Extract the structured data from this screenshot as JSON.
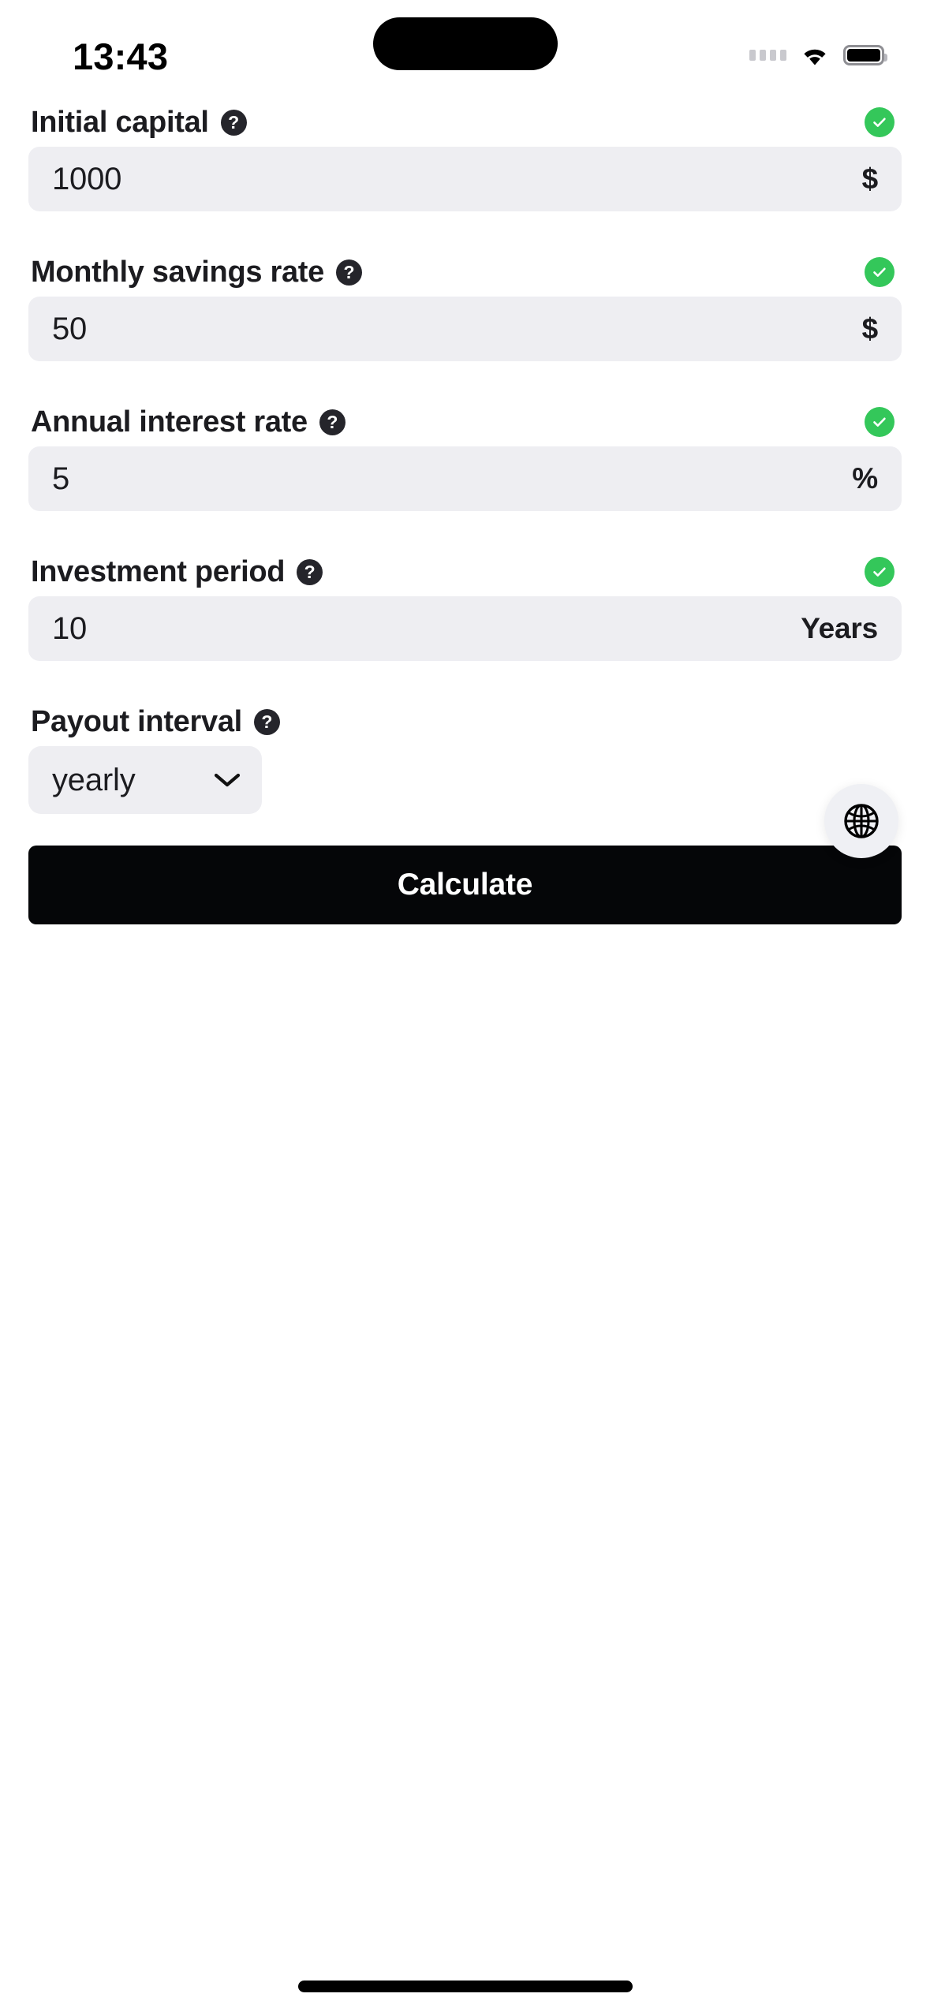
{
  "status_bar": {
    "time": "13:43",
    "signal_icon": "signal-dots-icon",
    "wifi_icon": "wifi-icon",
    "battery_icon": "battery-full-icon"
  },
  "form": {
    "help_glyph": "?",
    "fields": [
      {
        "label": "Initial capital",
        "value": "1000",
        "suffix": "$",
        "valid": true,
        "name": "initial-capital"
      },
      {
        "label": "Monthly savings rate",
        "value": "50",
        "suffix": "$",
        "valid": true,
        "name": "monthly-savings-rate"
      },
      {
        "label": "Annual interest rate",
        "value": "5",
        "suffix": "%",
        "valid": true,
        "name": "annual-interest-rate"
      },
      {
        "label": "Investment period",
        "value": "10",
        "suffix": "Years",
        "valid": true,
        "name": "investment-period"
      }
    ],
    "payout_interval": {
      "label": "Payout interval",
      "selected": "yearly"
    }
  },
  "actions": {
    "calculate_label": "Calculate",
    "language_icon": "globe-icon"
  },
  "colors": {
    "accent_valid": "#34c75a",
    "field_background": "#eeeef2",
    "button_background": "#050608",
    "text_primary": "#1c1c20"
  }
}
